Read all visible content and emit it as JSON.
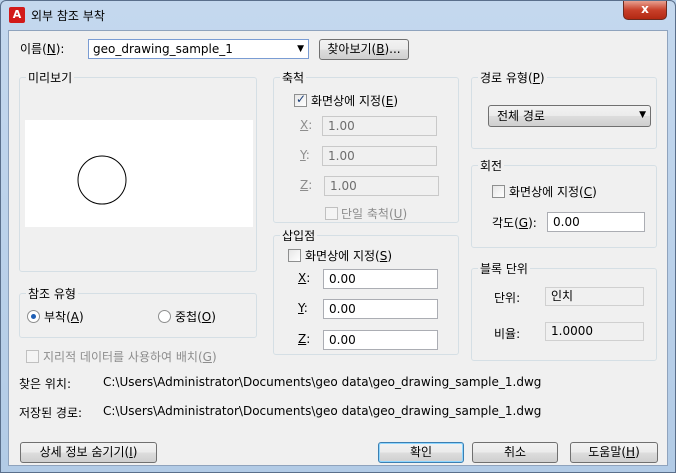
{
  "window": {
    "title": "외부 참조 부착",
    "app_logo": "A",
    "close": "x"
  },
  "name": {
    "label_prefix": "이름(",
    "label_key": "N",
    "label_suffix": "):",
    "value": "geo_drawing_sample_1",
    "browse_prefix": "찾아보기(",
    "browse_key": "B",
    "browse_suffix": ")..."
  },
  "preview": {
    "title": "미리보기"
  },
  "scale": {
    "title": "축척",
    "specify_prefix": "화면상에 지정(",
    "specify_key": "E",
    "specify_suffix": ")",
    "x_key": "X",
    "y_key": "Y",
    "z_key": "Z",
    "colon": ":",
    "x_value": "1.00",
    "y_value": "1.00",
    "z_value": "1.00",
    "uniform_prefix": "단일 축척(",
    "uniform_key": "U",
    "uniform_suffix": ")"
  },
  "insertion": {
    "title": "삽입점",
    "specify_prefix": "화면상에 지정(",
    "specify_key": "S",
    "specify_suffix": ")",
    "x_value": "0.00",
    "y_value": "0.00",
    "z_value": "0.00"
  },
  "path_type": {
    "title_prefix": "경로 유형(",
    "title_key": "P",
    "title_suffix": ")",
    "value": "전체 경로"
  },
  "rotation": {
    "title": "회전",
    "specify_prefix": "화면상에 지정(",
    "specify_key": "C",
    "specify_suffix": ")",
    "angle_prefix": "각도(",
    "angle_key": "G",
    "angle_suffix": "):",
    "angle_value": "0.00"
  },
  "block_unit": {
    "title": "블록 단위",
    "unit_label": "단위:",
    "unit_value": "인치",
    "factor_label": "비율:",
    "factor_value": "1.0000"
  },
  "reference_type": {
    "title": "참조 유형",
    "attach_prefix": "부착(",
    "attach_key": "A",
    "attach_suffix": ")",
    "overlay_prefix": "중첩(",
    "overlay_key": "O",
    "overlay_suffix": ")"
  },
  "geo": {
    "prefix": "지리적 데이터를 사용하여 배치(",
    "key": "G",
    "suffix": ")"
  },
  "found_in": {
    "label": "찾은 위치:",
    "value": "C:\\Users\\Administrator\\Documents\\geo data\\geo_drawing_sample_1.dwg"
  },
  "saved_path": {
    "label": "저장된 경로:",
    "value": "C:\\Users\\Administrator\\Documents\\geo data\\geo_drawing_sample_1.dwg"
  },
  "buttons": {
    "details_prefix": "상세 정보 숨기기(",
    "details_key": "I",
    "details_suffix": ")",
    "ok": "확인",
    "cancel": "취소",
    "help_prefix": "도움말(",
    "help_key": "H",
    "help_suffix": ")"
  },
  "icons": {
    "combo_arrow": "▼",
    "check": "✓"
  }
}
